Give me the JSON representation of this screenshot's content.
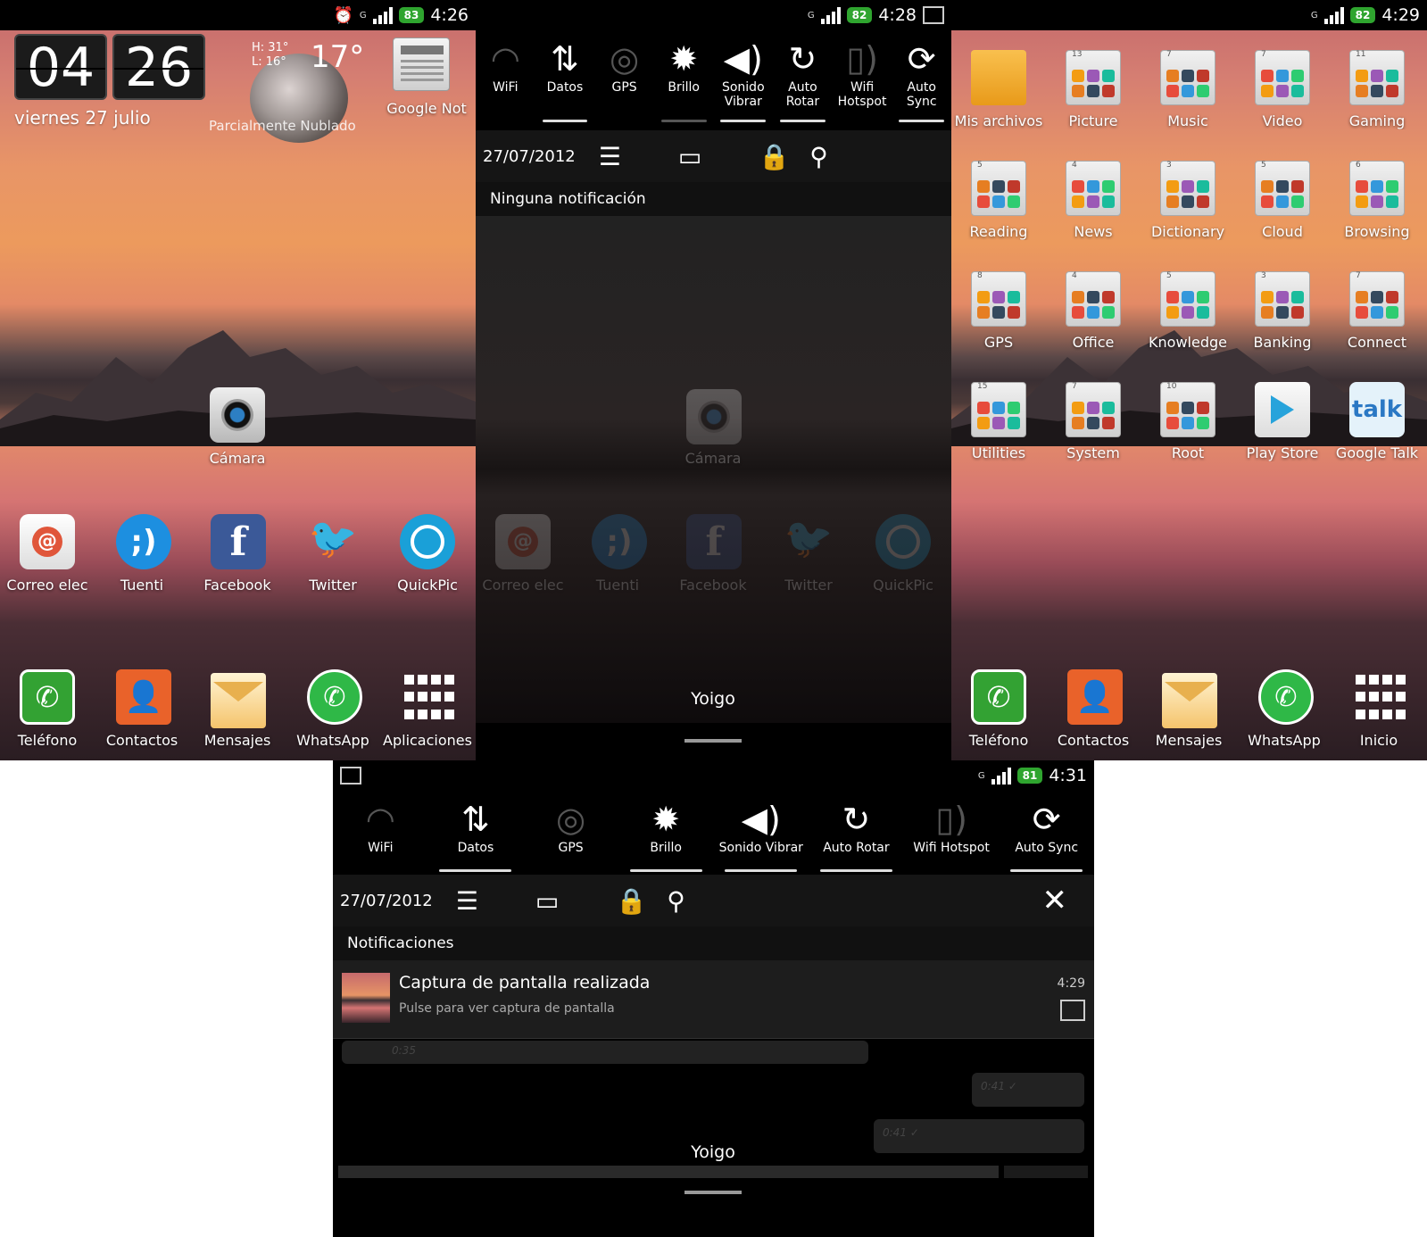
{
  "screen1": {
    "status_time": "4:26",
    "battery": "83",
    "network": "G",
    "clock_hours": "04",
    "clock_minutes": "26",
    "date": "viernes 27 julio",
    "weather_high": "H: 31°",
    "weather_low": "L: 16°",
    "weather_temp": "17°",
    "weather_desc": "Parcialmente Nublado",
    "news_widget_label": "Google Not",
    "camera_label": "Cámara",
    "row_apps": [
      "Correo elec",
      "Tuenti",
      "Facebook",
      "Twitter",
      "QuickPic"
    ],
    "dock": [
      "Teléfono",
      "Contactos",
      "Mensajes",
      "WhatsApp",
      "Aplicaciones"
    ]
  },
  "screen2": {
    "status_time": "4:28",
    "battery": "82",
    "network": "G",
    "toggles": [
      {
        "label": "WiFi",
        "icon": "wifi-icon"
      },
      {
        "label": "Datos",
        "icon": "data-icon"
      },
      {
        "label": "GPS",
        "icon": "gps-icon"
      },
      {
        "label": "Brillo",
        "icon": "brightness-icon"
      },
      {
        "label": "Sonido Vibrar",
        "icon": "sound-icon"
      },
      {
        "label": "Auto Rotar",
        "icon": "rotate-icon"
      },
      {
        "label": "Wifi Hotspot",
        "icon": "hotspot-icon"
      },
      {
        "label": "Auto Sync",
        "icon": "sync-icon"
      }
    ],
    "date": "27/07/2012",
    "section_title": "Ninguna notificación",
    "camera_label": "Cámara",
    "row_apps": [
      "Correo elec",
      "Tuenti",
      "Facebook",
      "Twitter",
      "QuickPic"
    ],
    "carrier": "Yoigo"
  },
  "screen3": {
    "status_time": "4:29",
    "battery": "82",
    "network": "G",
    "folders": [
      {
        "label": "Mis archivos",
        "count": ""
      },
      {
        "label": "Picture",
        "count": "13"
      },
      {
        "label": "Music",
        "count": "7"
      },
      {
        "label": "Video",
        "count": "7"
      },
      {
        "label": "Gaming",
        "count": "11"
      },
      {
        "label": "Reading",
        "count": "5"
      },
      {
        "label": "News",
        "count": "4"
      },
      {
        "label": "Dictionary",
        "count": "3"
      },
      {
        "label": "Cloud",
        "count": "5"
      },
      {
        "label": "Browsing",
        "count": "6"
      },
      {
        "label": "GPS",
        "count": "8"
      },
      {
        "label": "Office",
        "count": "4"
      },
      {
        "label": "Knowledge",
        "count": "5"
      },
      {
        "label": "Banking",
        "count": "3"
      },
      {
        "label": "Connect",
        "count": "7"
      },
      {
        "label": "Utilities",
        "count": "15"
      },
      {
        "label": "System",
        "count": "7"
      },
      {
        "label": "Root",
        "count": "10"
      },
      {
        "label": "Play Store",
        "count": ""
      },
      {
        "label": "Google Talk",
        "count": ""
      }
    ],
    "talk_logo": "talk",
    "dock": [
      "Teléfono",
      "Contactos",
      "Mensajes",
      "WhatsApp",
      "Inicio"
    ]
  },
  "screen4": {
    "status_time": "4:31",
    "battery": "81",
    "network": "G",
    "toggles": [
      {
        "label": "WiFi",
        "icon": "wifi-icon"
      },
      {
        "label": "Datos",
        "icon": "data-icon"
      },
      {
        "label": "GPS",
        "icon": "gps-icon"
      },
      {
        "label": "Brillo",
        "icon": "brightness-icon"
      },
      {
        "label": "Sonido Vibrar",
        "icon": "sound-icon"
      },
      {
        "label": "Auto Rotar",
        "icon": "rotate-icon"
      },
      {
        "label": "Wifi Hotspot",
        "icon": "hotspot-icon"
      },
      {
        "label": "Auto Sync",
        "icon": "sync-icon"
      }
    ],
    "date": "27/07/2012",
    "section_title": "Notificaciones",
    "notification": {
      "title": "Captura de pantalla realizada",
      "subtitle": "Pulse para ver captura de pantalla",
      "time": "4:29"
    },
    "bubbles": [
      "0:35",
      "0:41 ✓",
      "0:41 ✓"
    ],
    "carrier": "Yoigo"
  },
  "colors": {
    "battery_green": "#2fa52f",
    "panel_bg": "#000000",
    "toolbar_bg": "#151515"
  }
}
